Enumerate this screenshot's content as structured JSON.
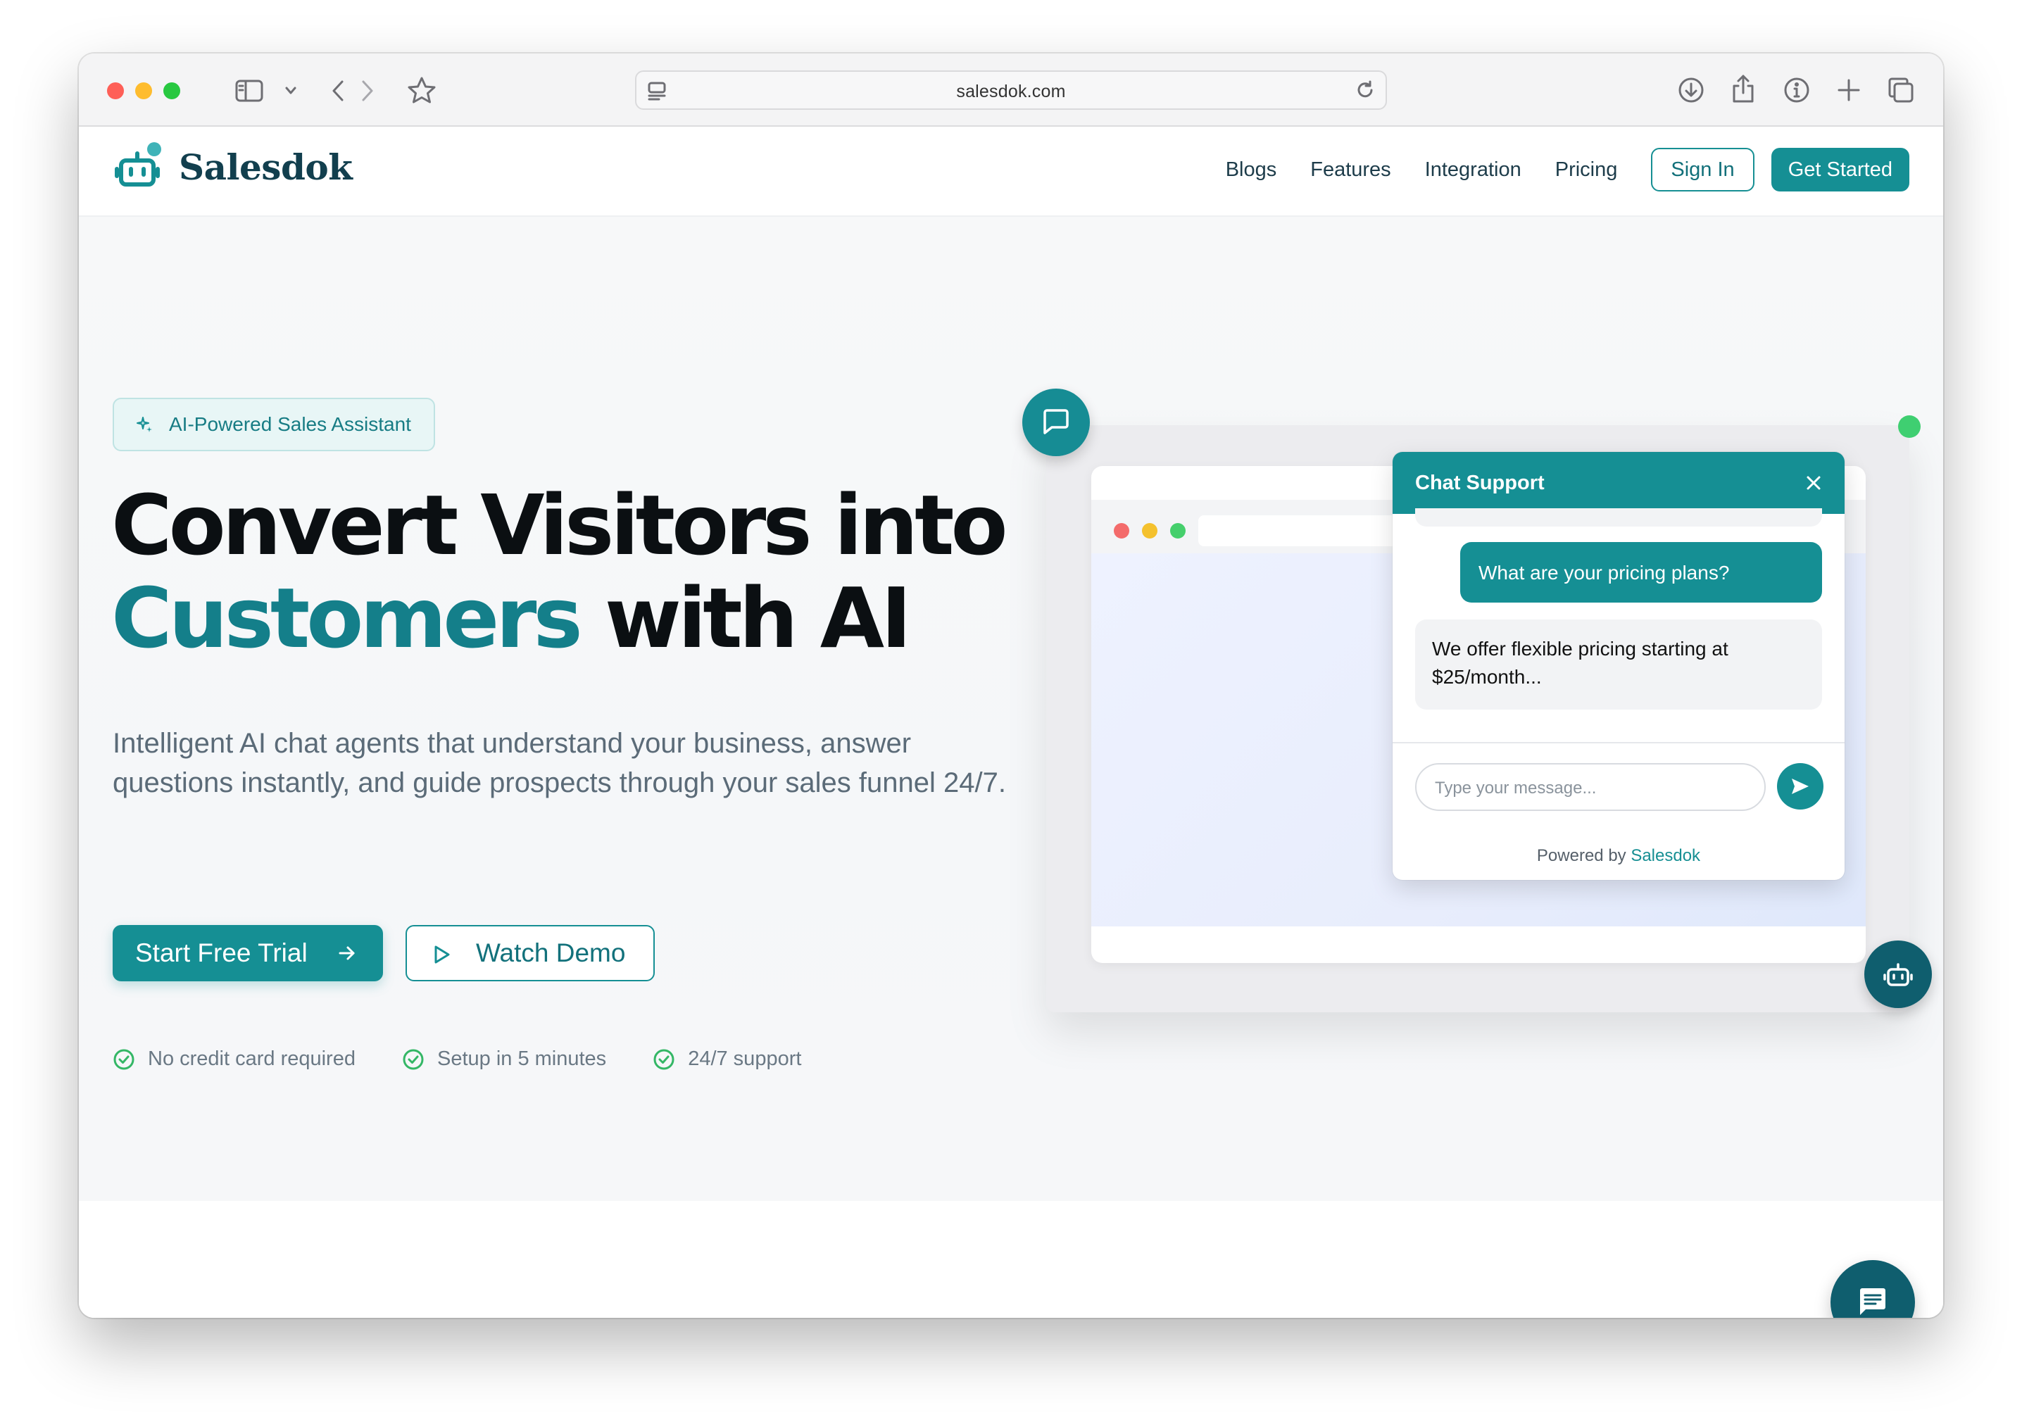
{
  "browser": {
    "url": "salesdok.com",
    "icons": [
      "sidebar-icon",
      "chevron-down-icon",
      "back-icon",
      "forward-icon",
      "star-icon",
      "reader-icon",
      "reload-icon",
      "download-icon",
      "share-icon",
      "info-icon",
      "new-tab-icon",
      "tabs-overview-icon"
    ]
  },
  "nav": {
    "brand": "Salesdok",
    "links": [
      "Blogs",
      "Features",
      "Integration",
      "Pricing"
    ],
    "sign_in": "Sign In",
    "get_started": "Get Started"
  },
  "hero": {
    "badge": "AI-Powered Sales Assistant",
    "headline_line1": "Convert Visitors into",
    "headline_accent": "Customers",
    "headline_rest": " with AI",
    "subtext": "Intelligent AI chat agents that understand your business, answer questions instantly, and guide prospects through your sales funnel 24/7.",
    "primary_cta": "Start Free Trial",
    "secondary_cta": "Watch Demo",
    "checks": [
      "No credit card required",
      "Setup in 5 minutes",
      "24/7 support"
    ]
  },
  "chat_widget": {
    "title": "Chat Support",
    "user_message": "What are your pricing plans?",
    "bot_message": "We offer flexible pricing starting at $25/month...",
    "input_placeholder": "Type your message...",
    "powered_prefix": "Powered by ",
    "powered_brand": "Salesdok"
  },
  "colors": {
    "brand_teal": "#158f94",
    "brand_dark": "#0f5e6e",
    "headline": "#0b0f12",
    "status_green": "#3fcf71"
  }
}
